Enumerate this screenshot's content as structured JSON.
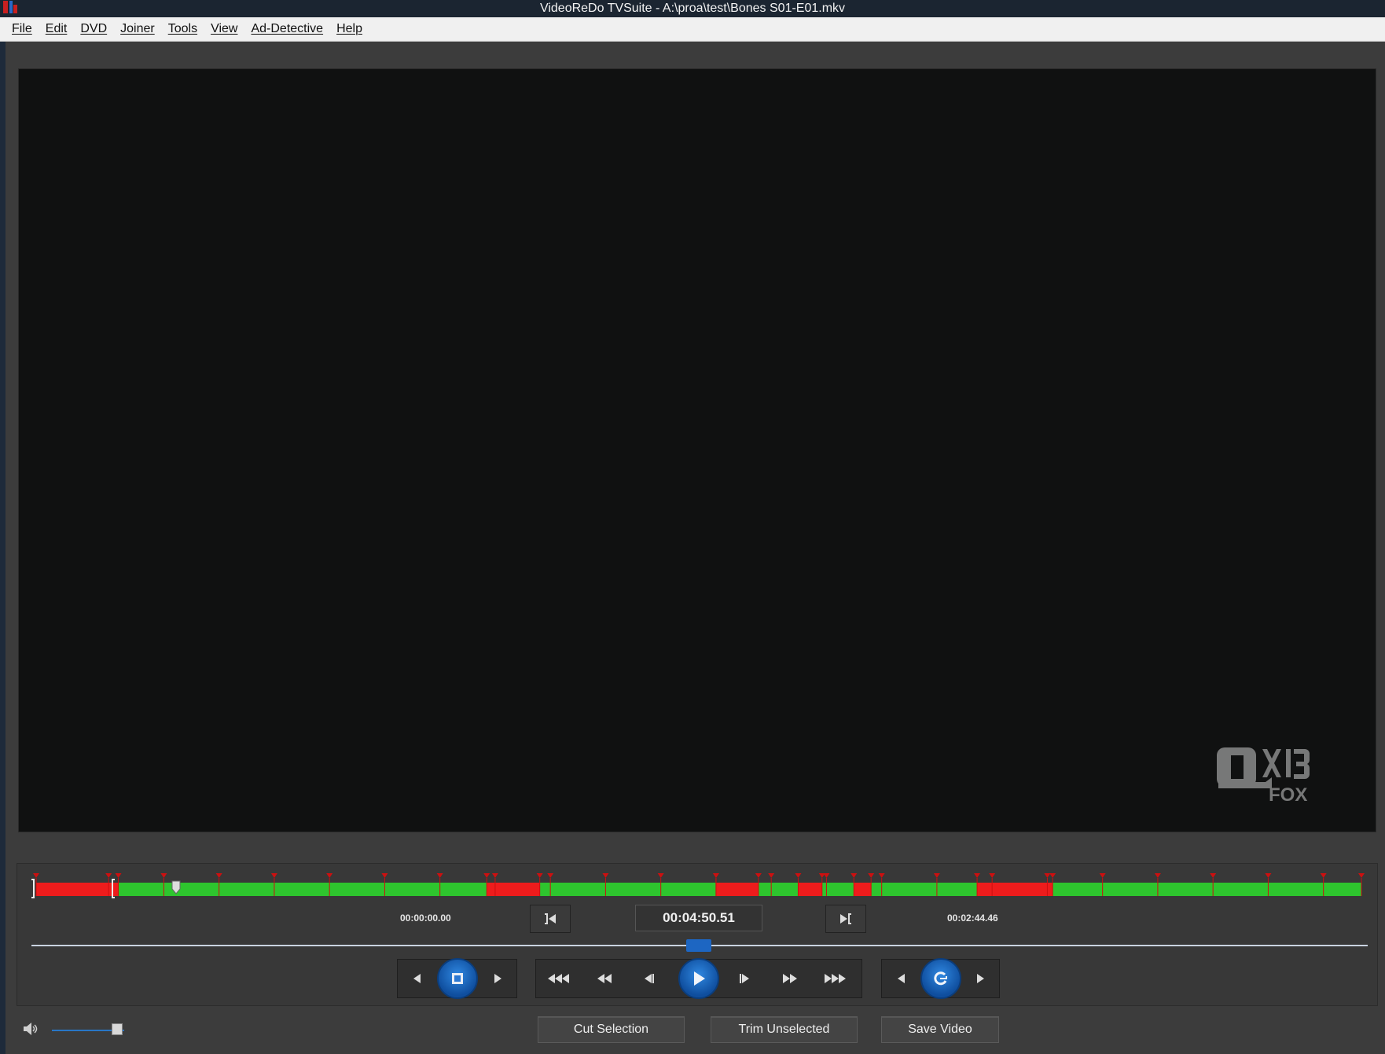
{
  "window": {
    "title": "VideoReDo TVSuite - A:\\proa\\test\\Bones S01-E01.mkv"
  },
  "menu": [
    "File",
    "Edit",
    "DVD",
    "Joiner",
    "Tools",
    "View",
    "Ad-Detective",
    "Help"
  ],
  "video": {
    "logo_icon": "q13-fox-watermark"
  },
  "timeline": {
    "start_time": "00:00:00.00",
    "current_time": "00:04:50.51",
    "end_time": "00:02:44.46",
    "scrub_position_fraction": 0.496,
    "segments_fraction": [
      {
        "from": 0.0,
        "to": 0.062,
        "state": "cut"
      },
      {
        "from": 0.062,
        "to": 0.34,
        "state": "keep"
      },
      {
        "from": 0.34,
        "to": 0.38,
        "state": "cut"
      },
      {
        "from": 0.38,
        "to": 0.513,
        "state": "keep"
      },
      {
        "from": 0.513,
        "to": 0.545,
        "state": "cut"
      },
      {
        "from": 0.545,
        "to": 0.575,
        "state": "keep"
      },
      {
        "from": 0.575,
        "to": 0.593,
        "state": "cut"
      },
      {
        "from": 0.593,
        "to": 0.617,
        "state": "keep"
      },
      {
        "from": 0.617,
        "to": 0.63,
        "state": "cut"
      },
      {
        "from": 0.63,
        "to": 0.71,
        "state": "keep"
      },
      {
        "from": 0.71,
        "to": 0.767,
        "state": "cut"
      },
      {
        "from": 0.767,
        "to": 1.0,
        "state": "keep"
      }
    ],
    "colors": {
      "keep": "#2ec52e",
      "cut": "#ee1c1c",
      "marker": "#cc1010"
    }
  },
  "controls": {
    "group1": [
      "prev-icon",
      "stop-icon",
      "next-icon"
    ],
    "group2": [
      "rewind-fast-icon",
      "rewind-icon",
      "step-back-icon",
      "play-icon",
      "step-forward-icon",
      "fast-forward-icon",
      "fast-forward-max-icon"
    ],
    "group3": [
      "left-icon",
      "loop-icon",
      "right-icon"
    ],
    "goto_start_icon": "goto-selection-start-icon",
    "goto_end_icon": "goto-selection-end-icon"
  },
  "actions": {
    "cut_label": "Cut Selection",
    "trim_label": "Trim Unselected",
    "save_label": "Save Video"
  },
  "volume": {
    "level_fraction": 0.8,
    "icon": "speaker-icon"
  }
}
